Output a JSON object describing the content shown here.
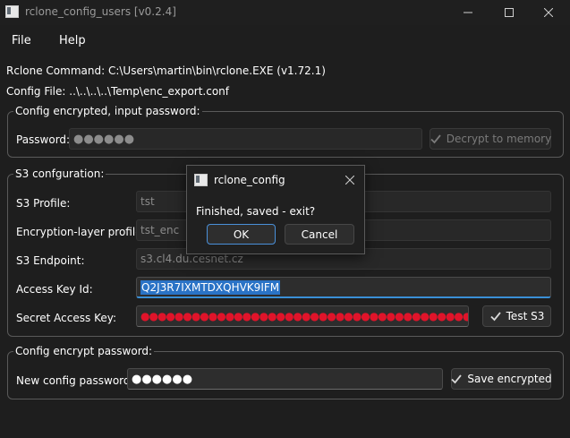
{
  "window": {
    "title": "rclone_config_users [v0.2.4]"
  },
  "menu": {
    "file": "File",
    "help": "Help"
  },
  "info": {
    "rclone_command": "Rclone Command: C:\\Users\\martin\\bin\\rclone.EXE (v1.72.1)",
    "config_file": "Config File: ..\\..\\..\\..\\Temp\\enc_export.conf"
  },
  "decrypt_group": {
    "title": "Config encrypted, input password:",
    "password_label": "Password:",
    "password_value": "●●●●●●",
    "decrypt_button": "Decrypt to memory"
  },
  "s3_group": {
    "title": "S3 confguration:",
    "profile_label": "S3 Profile:",
    "profile_value": "tst",
    "enc_profile_label": "Encryption-layer profile:",
    "enc_profile_value": "tst_enc",
    "endpoint_label": "S3 Endpoint:",
    "endpoint_value": "s3.cl4.du.cesnet.cz",
    "access_key_label": "Access Key Id:",
    "access_key_value": "Q2J3R7IXMTDXQHVK9IFM",
    "secret_key_label": "Secret Access Key:",
    "secret_key_value": "●●●●●●●●●●●●●●●●●●●●●●●●●●●●●●●●●●●●●●●●",
    "test_button": "Test S3"
  },
  "encrypt_group": {
    "title": "Config encrypt password:",
    "new_password_label": "New config password:",
    "new_password_value": "●●●●●●",
    "save_button": "Save encrypted"
  },
  "dialog": {
    "title": "rclone_config",
    "message": "Finished, saved - exit?",
    "ok": "OK",
    "cancel": "Cancel"
  },
  "colors": {
    "background": "#1e1e1e",
    "accent": "#3a8fd6",
    "secret_dots": "#e0142a"
  }
}
